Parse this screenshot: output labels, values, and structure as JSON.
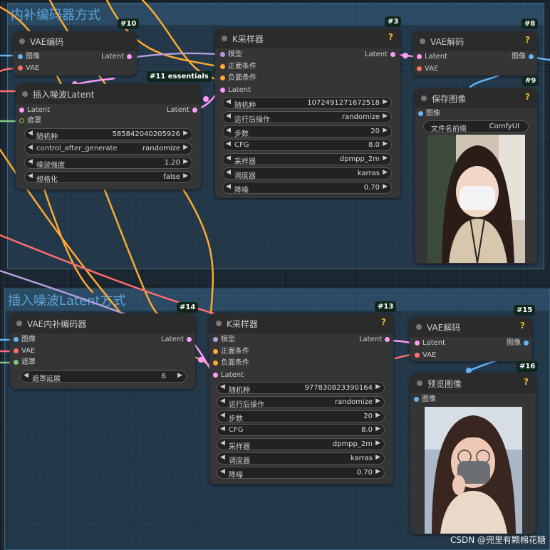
{
  "groups": {
    "top_title": "内补编码器方式",
    "bottom_title": "插入噪波Latent方式"
  },
  "colors": {
    "image": "#64b5f6",
    "vae": "#ff6e6e",
    "latent": "#ff9cf9",
    "model": "#b39ddb",
    "conditioning": "#ffa931",
    "mask": "#81c784",
    "badge_bg": "#10261c",
    "help": "#f0b429"
  },
  "nodes": {
    "n10": {
      "badge": "#10",
      "title": "VAE编码",
      "in_image": "图像",
      "in_vae": "VAE",
      "out_latent": "Latent"
    },
    "n11": {
      "badge": "#11 essentials",
      "title": "插入噪波Latent",
      "in_latent": "Latent",
      "in_mask": "遮罩",
      "out_latent": "Latent",
      "widgets": [
        {
          "label": "随机种",
          "value": "585842040205926"
        },
        {
          "label": "control_after_generate",
          "value": "randomize"
        },
        {
          "label": "噪波强度",
          "value": "1.20"
        },
        {
          "label": "规格化",
          "value": "false"
        }
      ]
    },
    "n3": {
      "badge": "#3",
      "title": "K采样器",
      "help": "?",
      "in_model": "模型",
      "in_pos": "正面条件",
      "in_neg": "负面条件",
      "in_latent": "Latent",
      "out_latent": "Latent",
      "widgets": [
        {
          "label": "随机种",
          "value": "1072491271672518"
        },
        {
          "label": "运行后操作",
          "value": "randomize"
        },
        {
          "label": "步数",
          "value": "20"
        },
        {
          "label": "CFG",
          "value": "8.0"
        },
        {
          "label": "采样器",
          "value": "dpmpp_2m"
        },
        {
          "label": "调度器",
          "value": "karras"
        },
        {
          "label": "降噪",
          "value": "0.70"
        }
      ]
    },
    "n8": {
      "badge": "#8",
      "title": "VAE解码",
      "help": "?",
      "in_latent": "Latent",
      "in_vae": "VAE",
      "out_image": "图像"
    },
    "n9": {
      "badge": "#9",
      "title": "保存图像",
      "help": "?",
      "in_image": "图像",
      "prefix_label": "文件名前缀",
      "prefix_value": "ComfyUI"
    },
    "n14": {
      "badge": "#14",
      "title": "VAE内补编码器",
      "in_image": "图像",
      "in_vae": "VAE",
      "in_mask": "遮罩",
      "out_latent": "Latent",
      "widgets": [
        {
          "label": "遮罩延展",
          "value": "6"
        }
      ]
    },
    "n13": {
      "badge": "#13",
      "title": "K采样器",
      "help": "?",
      "in_model": "模型",
      "in_pos": "正面条件",
      "in_neg": "负面条件",
      "in_latent": "Latent",
      "out_latent": "Latent",
      "widgets": [
        {
          "label": "随机种",
          "value": "977830823390164"
        },
        {
          "label": "运行后操作",
          "value": "randomize"
        },
        {
          "label": "步数",
          "value": "20"
        },
        {
          "label": "CFG",
          "value": "8.0"
        },
        {
          "label": "采样器",
          "value": "dpmpp_2m"
        },
        {
          "label": "调度器",
          "value": "karras"
        },
        {
          "label": "降噪",
          "value": "0.70"
        }
      ]
    },
    "n15": {
      "badge": "#15",
      "title": "VAE解码",
      "help": "?",
      "in_latent": "Latent",
      "in_vae": "VAE",
      "out_image": "图像"
    },
    "n16": {
      "badge": "#16",
      "title": "预览图像",
      "help": "?",
      "in_image": "图像"
    }
  },
  "watermark": "CSDN @兜里有颗棉花糖"
}
